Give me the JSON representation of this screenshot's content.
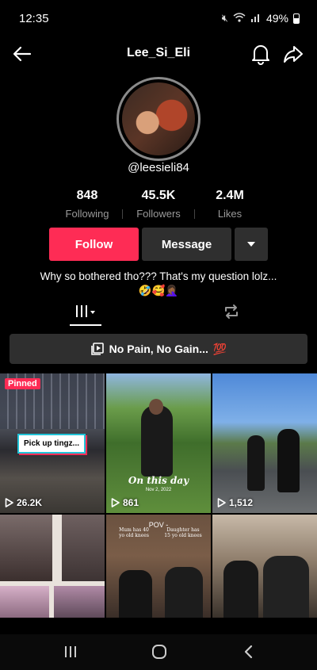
{
  "status_bar": {
    "time": "12:35",
    "battery": "49%"
  },
  "header": {
    "title": "Lee_Si_Eli"
  },
  "profile": {
    "username": "@leesieli84",
    "bio_line1": "Why so bothered tho??? That's my question lolz...",
    "bio_line2": "🤣🥰🤦🏾‍♀️"
  },
  "stats": [
    {
      "value": "848",
      "label": "Following"
    },
    {
      "value": "45.5K",
      "label": "Followers"
    },
    {
      "value": "2.4M",
      "label": "Likes"
    }
  ],
  "actions": {
    "follow": "Follow",
    "message": "Message"
  },
  "playlist": {
    "label": "No Pain, No Gain...",
    "emoji": "💯"
  },
  "videos": [
    {
      "views": "26.2K",
      "pinned": "Pinned",
      "caption": "Pick up tingz..."
    },
    {
      "views": "861",
      "overlay": "On this day",
      "overlay_sub": "Nov 2, 2022"
    },
    {
      "views": "1,512"
    },
    {},
    {
      "pov": "POV -",
      "meme_left": "Mum has 40 yo old knees",
      "meme_right": "Daughter has 15 yo old knees"
    },
    {}
  ],
  "colors": {
    "accent": "#fe2c55",
    "button_bg": "#2f2f2f",
    "background": "#000000"
  }
}
